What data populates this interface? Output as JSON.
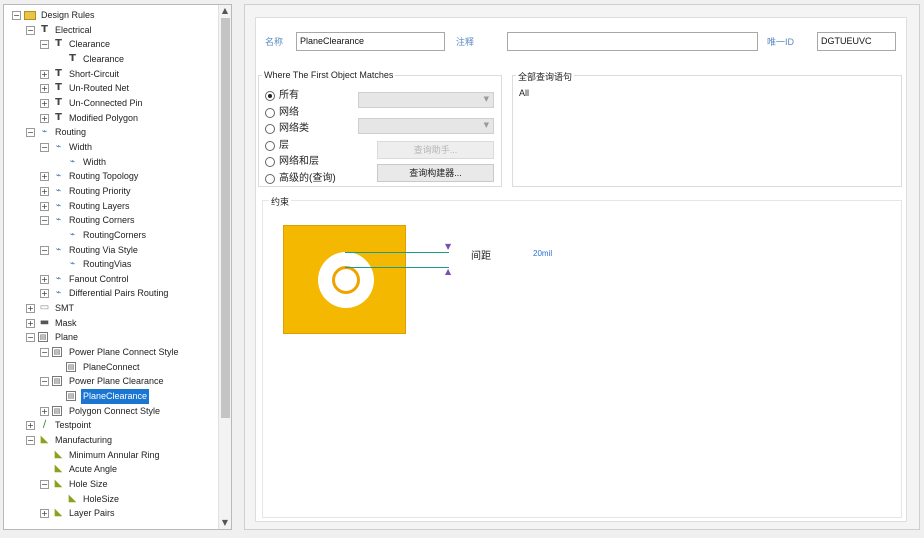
{
  "tree": {
    "rows": [
      {
        "label": "Design Rules",
        "expander": "⊟",
        "icon": "folder-root",
        "indent": 0
      },
      {
        "label": "Electrical",
        "expander": "⊟",
        "icon": "rule-t",
        "indent": 1
      },
      {
        "label": "Clearance",
        "expander": "⊟",
        "icon": "rule-t",
        "indent": 2
      },
      {
        "label": "Clearance",
        "expander": "",
        "icon": "rule-t",
        "indent": 3
      },
      {
        "label": "Short-Circuit",
        "expander": "⊞",
        "icon": "rule-t",
        "indent": 2
      },
      {
        "label": "Un-Routed Net",
        "expander": "⊞",
        "icon": "rule-t",
        "indent": 2
      },
      {
        "label": "Un-Connected Pin",
        "expander": "⊞",
        "icon": "rule-t",
        "indent": 2
      },
      {
        "label": "Modified Polygon",
        "expander": "⊞",
        "icon": "rule-t",
        "indent": 2
      },
      {
        "label": "Routing",
        "expander": "⊟",
        "icon": "route",
        "indent": 1
      },
      {
        "label": "Width",
        "expander": "⊟",
        "icon": "route",
        "indent": 2
      },
      {
        "label": "Width",
        "expander": "",
        "icon": "route",
        "indent": 3
      },
      {
        "label": "Routing Topology",
        "expander": "⊞",
        "icon": "route",
        "indent": 2
      },
      {
        "label": "Routing Priority",
        "expander": "⊞",
        "icon": "route",
        "indent": 2
      },
      {
        "label": "Routing Layers",
        "expander": "⊞",
        "icon": "route",
        "indent": 2
      },
      {
        "label": "Routing Corners",
        "expander": "⊟",
        "icon": "route",
        "indent": 2
      },
      {
        "label": "RoutingCorners",
        "expander": "",
        "icon": "route",
        "indent": 3
      },
      {
        "label": "Routing Via Style",
        "expander": "⊟",
        "icon": "route",
        "indent": 2
      },
      {
        "label": "RoutingVias",
        "expander": "",
        "icon": "route",
        "indent": 3
      },
      {
        "label": "Fanout Control",
        "expander": "⊞",
        "icon": "route",
        "indent": 2
      },
      {
        "label": "Differential Pairs Routing",
        "expander": "⊞",
        "icon": "route",
        "indent": 2
      },
      {
        "label": "SMT",
        "expander": "⊞",
        "icon": "smt",
        "indent": 1
      },
      {
        "label": "Mask",
        "expander": "⊞",
        "icon": "mask",
        "indent": 1
      },
      {
        "label": "Plane",
        "expander": "⊟",
        "icon": "plane-box",
        "indent": 1
      },
      {
        "label": "Power Plane Connect Style",
        "expander": "⊟",
        "icon": "plane-box",
        "indent": 2
      },
      {
        "label": "PlaneConnect",
        "expander": "",
        "icon": "plane-box",
        "indent": 3
      },
      {
        "label": "Power Plane Clearance",
        "expander": "⊟",
        "icon": "plane-box",
        "indent": 2
      },
      {
        "label": "PlaneClearance",
        "expander": "",
        "icon": "plane-box",
        "indent": 3,
        "selected": true
      },
      {
        "label": "Polygon Connect Style",
        "expander": "⊞",
        "icon": "plane-box",
        "indent": 2
      },
      {
        "label": "Testpoint",
        "expander": "⊞",
        "icon": "testpoint",
        "indent": 1
      },
      {
        "label": "Manufacturing",
        "expander": "⊟",
        "icon": "mfg",
        "indent": 1
      },
      {
        "label": "Minimum Annular Ring",
        "expander": "",
        "icon": "mfg",
        "indent": 2
      },
      {
        "label": "Acute Angle",
        "expander": "",
        "icon": "mfg",
        "indent": 2
      },
      {
        "label": "Hole Size",
        "expander": "⊟",
        "icon": "mfg",
        "indent": 2
      },
      {
        "label": "HoleSize",
        "expander": "",
        "icon": "mfg",
        "indent": 3
      },
      {
        "label": "Layer Pairs",
        "expander": "⊞",
        "icon": "mfg",
        "indent": 2
      }
    ]
  },
  "rule": {
    "name_label": "名称",
    "name_value": "PlaneClearance",
    "comment_label": "注释",
    "comment_value": "",
    "id_label": "唯一ID",
    "id_value": "DGTUEUVC"
  },
  "where_first": {
    "title": "Where The First Object Matches",
    "options": [
      {
        "label": "所有",
        "checked": true
      },
      {
        "label": "网络",
        "checked": false
      },
      {
        "label": "网络类",
        "checked": false
      },
      {
        "label": "层",
        "checked": false
      },
      {
        "label": "网络和层",
        "checked": false
      },
      {
        "label": "高级的(查询)",
        "checked": false
      }
    ],
    "query_helper_label": "查询助手...",
    "query_builder_label": "查询构建器..."
  },
  "full_query": {
    "title": "全部查询语句",
    "text": "All"
  },
  "constraints": {
    "title": "约束",
    "clearance_label": "间距",
    "clearance_value": "20mil"
  }
}
